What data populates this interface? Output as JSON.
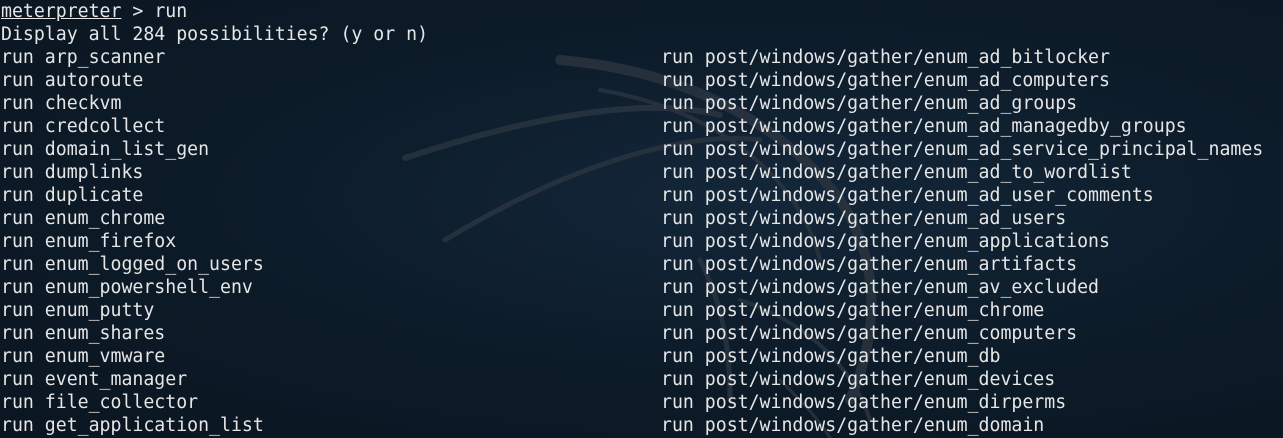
{
  "prompt": {
    "name": "meterpreter",
    "separator": " > ",
    "command": "run"
  },
  "completion_question": "Display all 284 possibilities? (y or n)",
  "left_column": [
    "run arp_scanner",
    "run autoroute",
    "run checkvm",
    "run credcollect",
    "run domain_list_gen",
    "run dumplinks",
    "run duplicate",
    "run enum_chrome",
    "run enum_firefox",
    "run enum_logged_on_users",
    "run enum_powershell_env",
    "run enum_putty",
    "run enum_shares",
    "run enum_vmware",
    "run event_manager",
    "run file_collector",
    "run get_application_list"
  ],
  "right_column": [
    "run post/windows/gather/enum_ad_bitlocker",
    "run post/windows/gather/enum_ad_computers",
    "run post/windows/gather/enum_ad_groups",
    "run post/windows/gather/enum_ad_managedby_groups",
    "run post/windows/gather/enum_ad_service_principal_names",
    "run post/windows/gather/enum_ad_to_wordlist",
    "run post/windows/gather/enum_ad_user_comments",
    "run post/windows/gather/enum_ad_users",
    "run post/windows/gather/enum_applications",
    "run post/windows/gather/enum_artifacts",
    "run post/windows/gather/enum_av_excluded",
    "run post/windows/gather/enum_chrome",
    "run post/windows/gather/enum_computers",
    "run post/windows/gather/enum_db",
    "run post/windows/gather/enum_devices",
    "run post/windows/gather/enum_dirperms",
    "run post/windows/gather/enum_domain"
  ],
  "colors": {
    "background": "#0c1a26",
    "text": "#e6e6e6"
  },
  "icons": {
    "watermark": "kali-dragon-icon"
  }
}
